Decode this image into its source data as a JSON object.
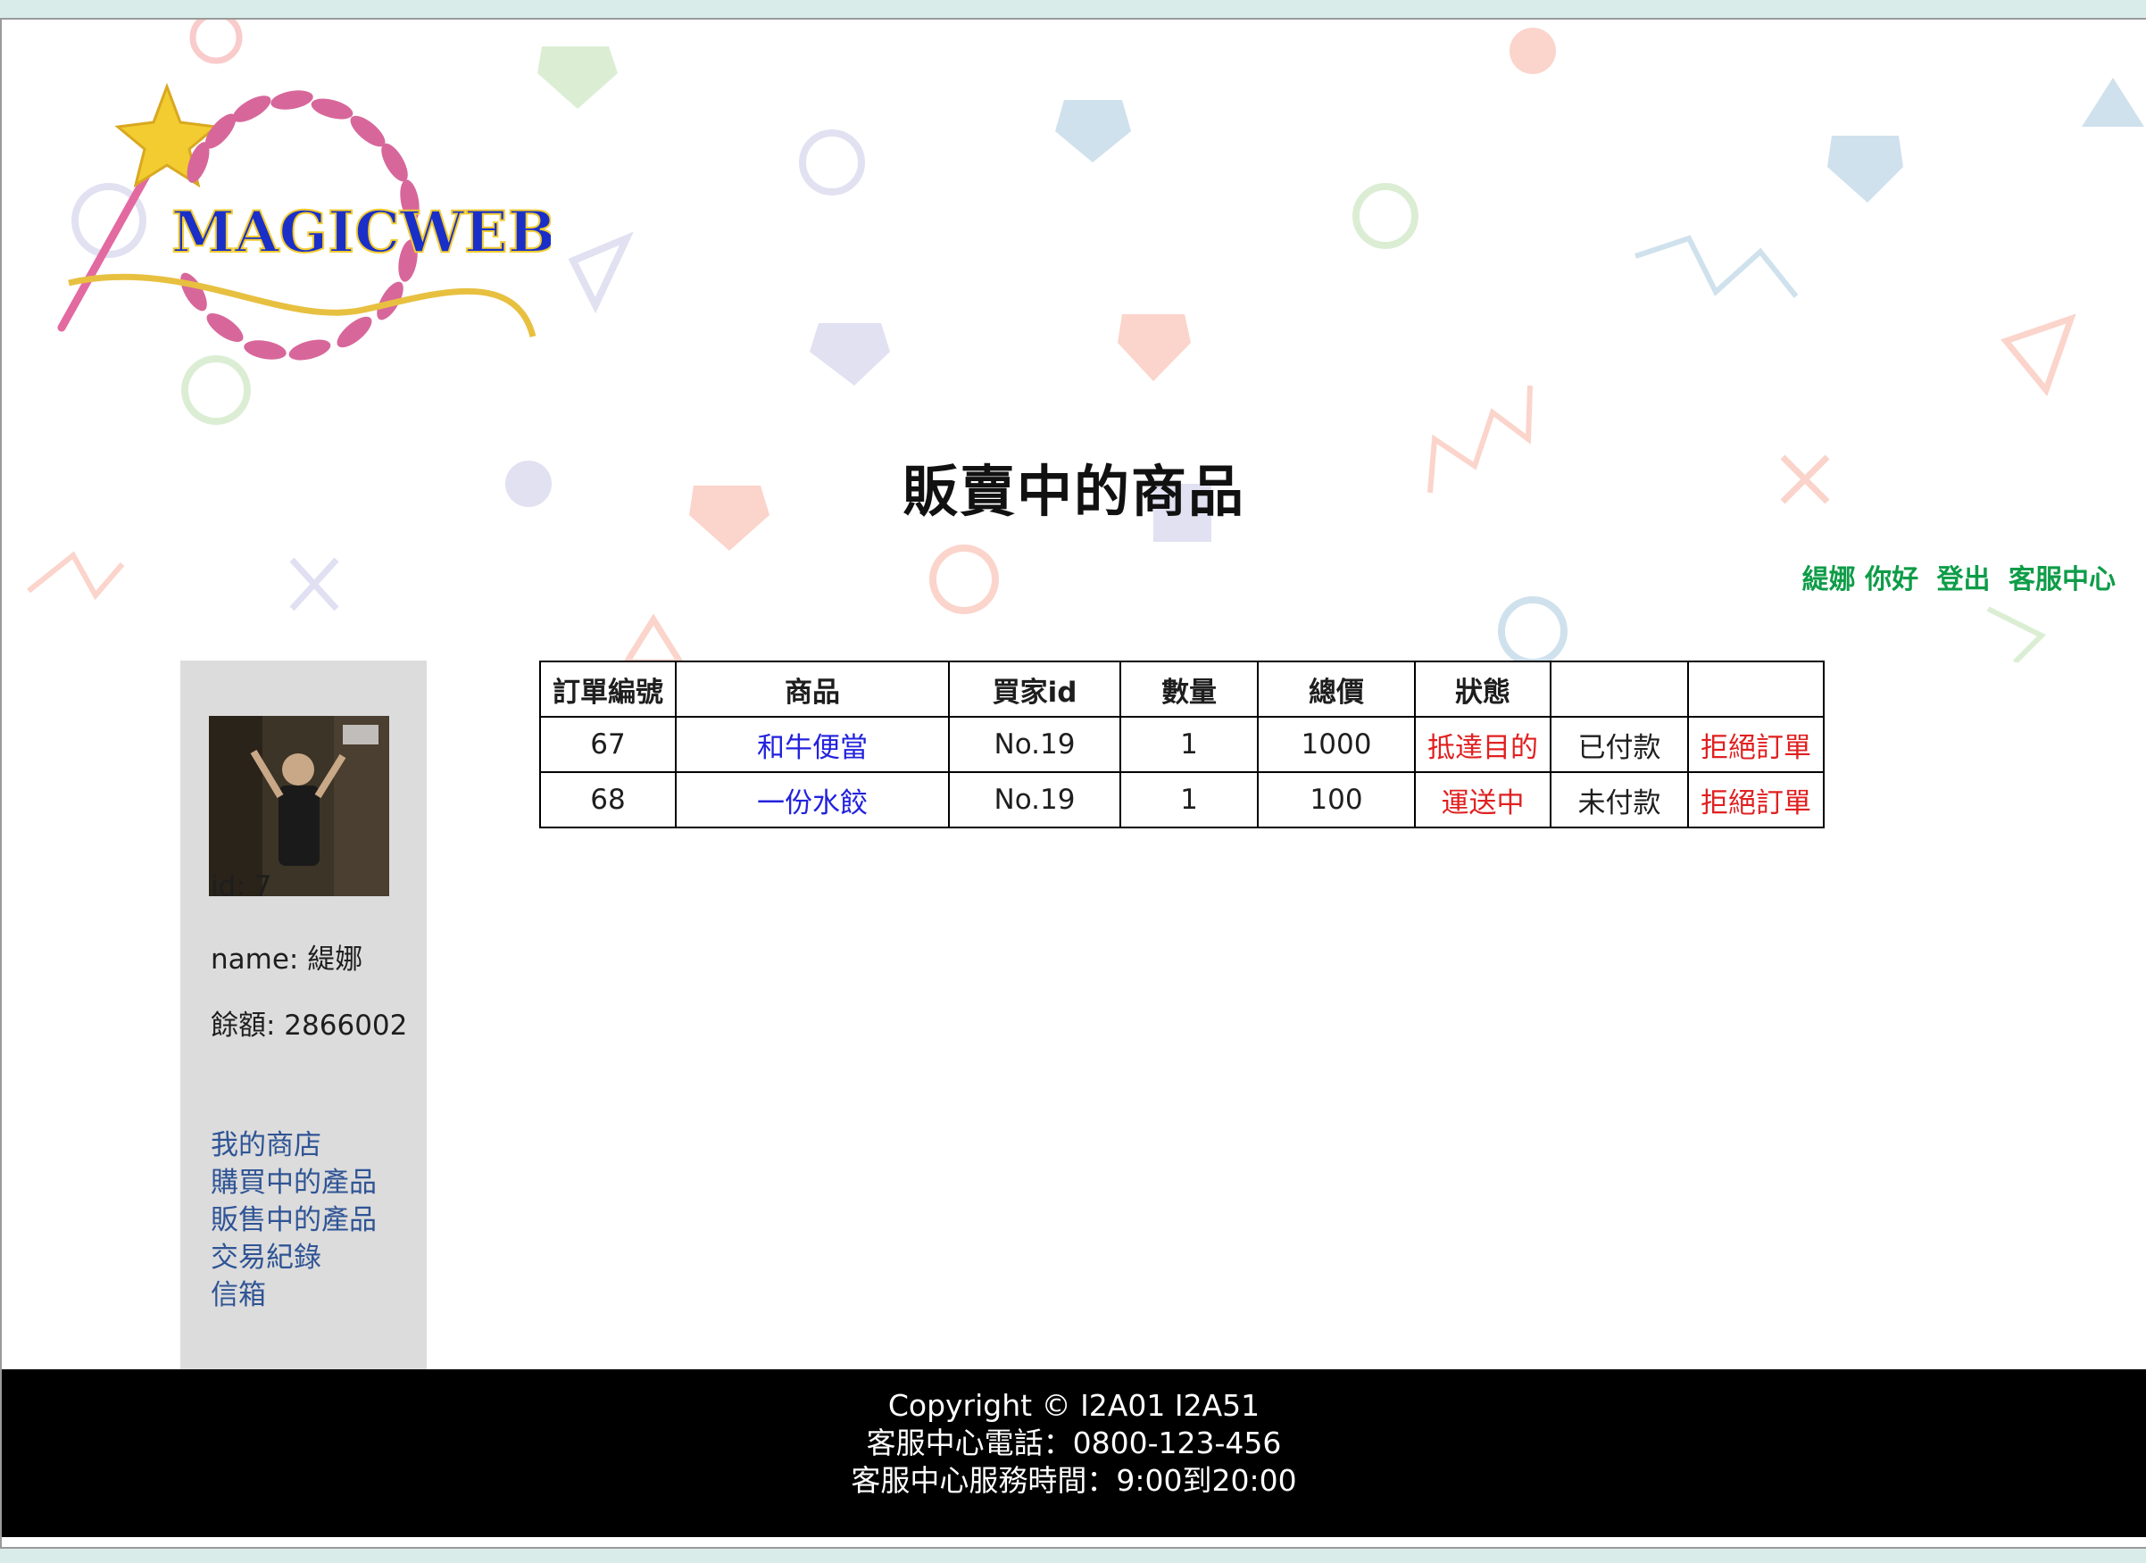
{
  "page": {
    "title": "販賣中的商品"
  },
  "header": {
    "logo_text": "MAGICWEB",
    "user_nav": {
      "greeting": "緹娜 你好",
      "logout": "登出",
      "support": "客服中心"
    }
  },
  "sidebar": {
    "id_text": "id: 7",
    "name_text": "name: 緹娜",
    "balance_text": "餘額: 2866002",
    "links": [
      "我的商店",
      "購買中的產品",
      "販售中的產品",
      "交易紀錄",
      "信箱"
    ]
  },
  "orders": {
    "headers": [
      "訂單編號",
      "商品",
      "買家id",
      "數量",
      "總價",
      "狀態",
      "",
      ""
    ],
    "rows": [
      {
        "order_id": "67",
        "product": "和牛便當",
        "buyer": "No.19",
        "qty": "1",
        "total": "1000",
        "status": "抵達目的",
        "payment": "已付款",
        "action": "拒絕訂單"
      },
      {
        "order_id": "68",
        "product": "一份水餃",
        "buyer": "No.19",
        "qty": "1",
        "total": "100",
        "status": "運送中",
        "payment": "未付款",
        "action": "拒絕訂單"
      }
    ]
  },
  "footer": {
    "line1": "Copyright © I2A01 I2A51",
    "line2": "客服中心電話：0800-123-456",
    "line3": "客服中心服務時間：9:00到20:00"
  },
  "colors": {
    "accent_green": "#0e9c48",
    "link_blue": "#2222dd",
    "status_red": "#e02020",
    "sidebar_bg": "#dcdcdc",
    "footer_bg": "#000000"
  }
}
